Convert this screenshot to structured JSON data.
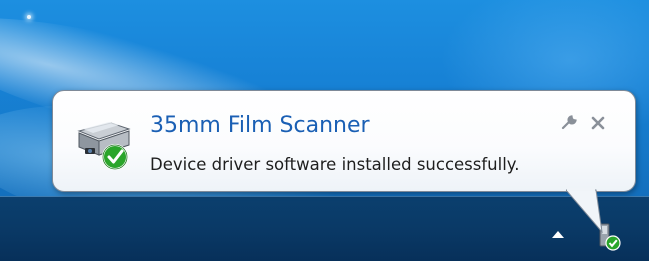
{
  "notification": {
    "title": "35mm Film Scanner",
    "message": "Device driver software installed successfully.",
    "device_icon": "scanner-icon",
    "status_icon": "checkmark-badge-icon",
    "options_icon": "wrench-icon",
    "close_icon": "close-icon",
    "title_color": "#1a5fb4"
  },
  "taskbar": {
    "tray_arrow_icon": "show-hidden-icons-arrow",
    "tray_device_icon": "device-installed-icon"
  },
  "colors": {
    "desktop_blue": "#1782d6",
    "taskbar_navy": "#0a3a67",
    "success_green": "#2aa52a"
  }
}
